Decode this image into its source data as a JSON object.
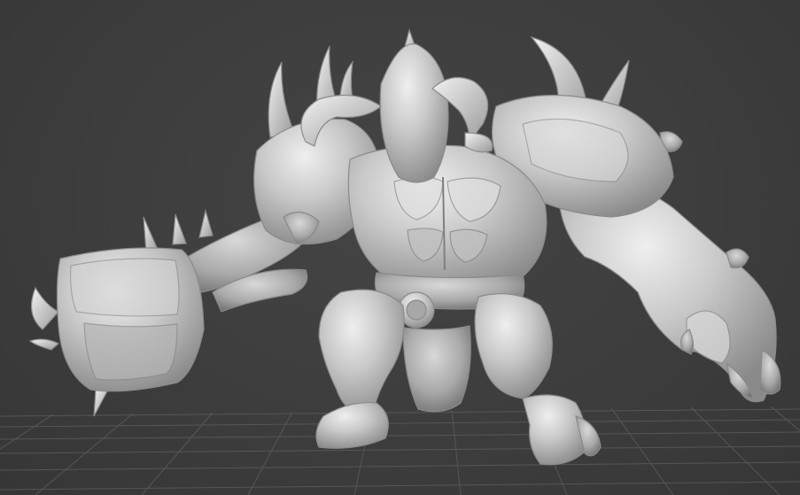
{
  "viewport": {
    "background_color": "#3d3d3d",
    "grid_color": "#5a5a5a",
    "model_color": "#c8c8c8",
    "model_shadow_color": "#7a7a7a",
    "model_highlight_color": "#ececec",
    "icon": "3d-model-icon"
  },
  "model": {
    "subject": "demon-brute-sculpt-icon",
    "weapon": "spiked-mace-icon",
    "shading": "matcap-gray"
  }
}
